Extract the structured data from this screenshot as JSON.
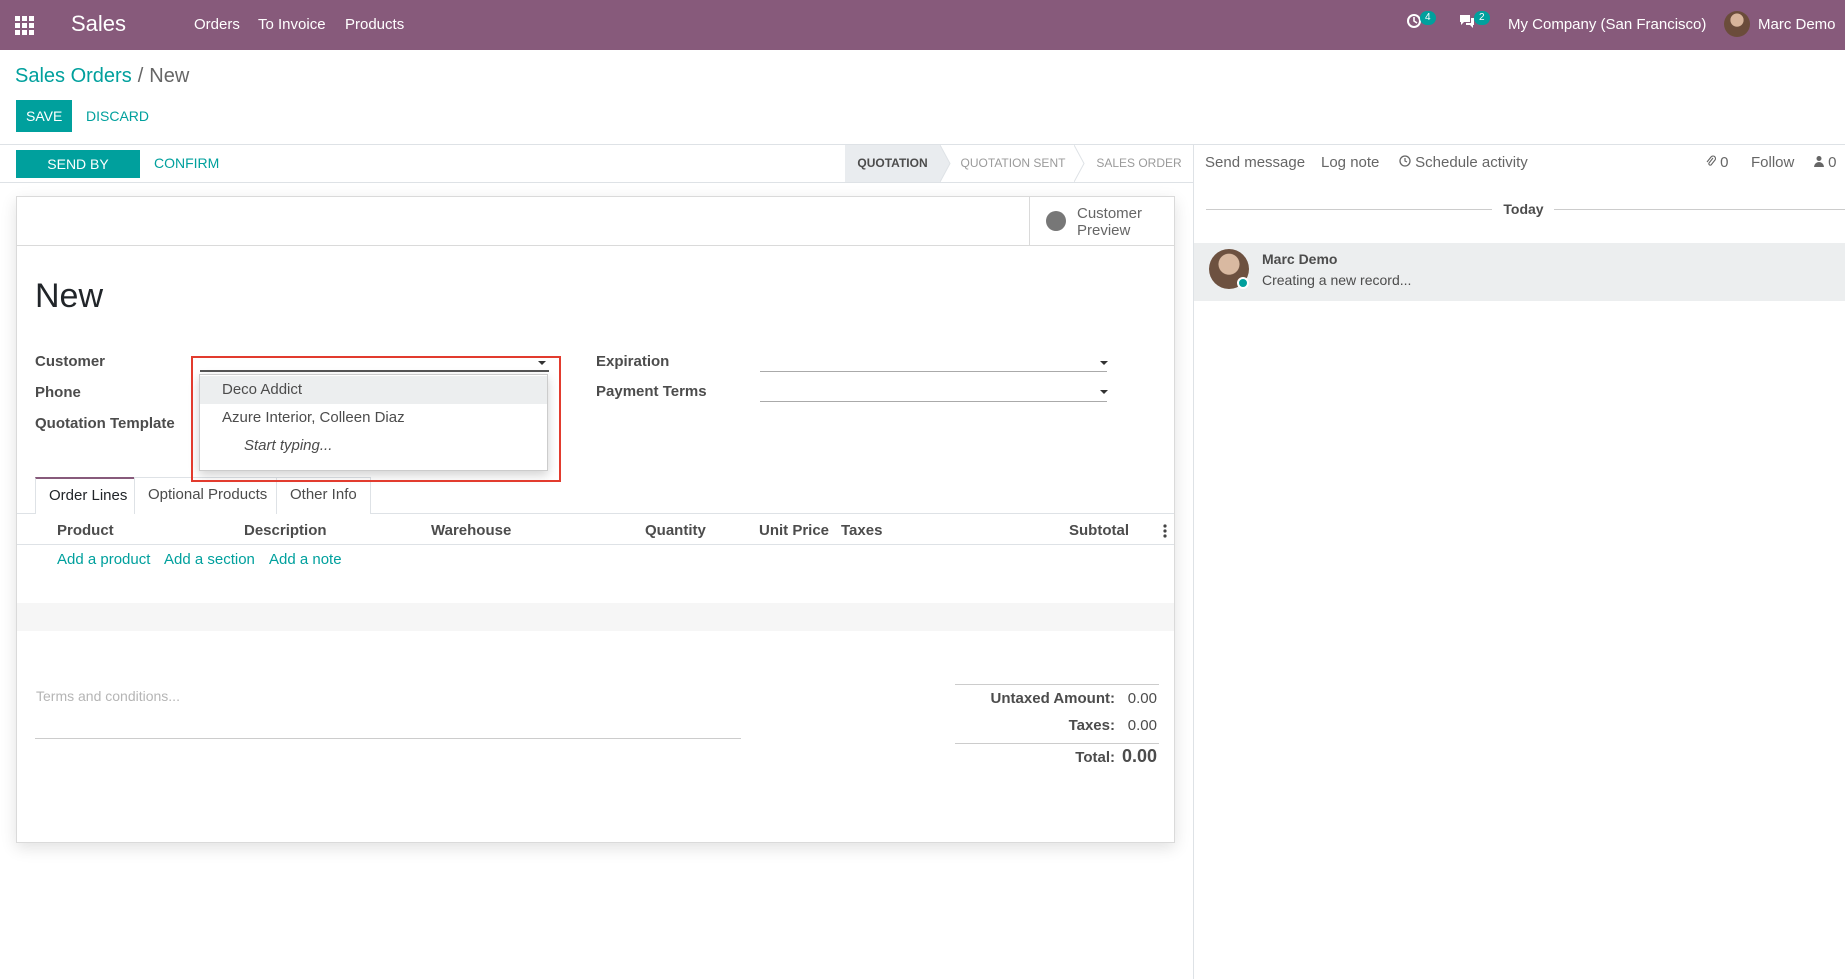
{
  "navbar": {
    "app_name": "Sales",
    "menu": [
      "Orders",
      "To Invoice",
      "Products"
    ],
    "activity_count": "4",
    "message_count": "2",
    "company": "My Company (San Francisco)",
    "user": "Marc Demo"
  },
  "breadcrumb": {
    "parent": "Sales Orders",
    "separator": "/",
    "current": "New"
  },
  "actions": {
    "save": "SAVE",
    "discard": "DISCARD",
    "send_email": "SEND BY EMAIL",
    "confirm": "CONFIRM"
  },
  "stages": [
    "QUOTATION",
    "QUOTATION SENT",
    "SALES ORDER"
  ],
  "active_stage": "QUOTATION",
  "stat_button": {
    "line1": "Customer",
    "line2": "Preview"
  },
  "record": {
    "title": "New"
  },
  "fields": {
    "customer": "Customer",
    "phone": "Phone",
    "quotation_template": "Quotation Template",
    "expiration": "Expiration",
    "payment_terms": "Payment Terms"
  },
  "dropdown": {
    "items": [
      "Deco Addict",
      "Azure Interior, Colleen Diaz"
    ],
    "hint": "Start typing..."
  },
  "tabs": [
    "Order Lines",
    "Optional Products",
    "Other Info"
  ],
  "order_lines": {
    "columns": [
      "Product",
      "Description",
      "Warehouse",
      "Quantity",
      "Unit Price",
      "Taxes",
      "Subtotal"
    ],
    "add_links": [
      "Add a product",
      "Add a section",
      "Add a note"
    ]
  },
  "terms_placeholder": "Terms and conditions...",
  "totals": {
    "untaxed_label": "Untaxed Amount:",
    "untaxed": "0.00",
    "taxes_label": "Taxes:",
    "taxes": "0.00",
    "total_label": "Total:",
    "total": "0.00"
  },
  "chatter": {
    "send_message": "Send message",
    "log_note": "Log note",
    "schedule_activity": "Schedule activity",
    "attachments": "0",
    "follow": "Follow",
    "followers": "0",
    "date_separator": "Today",
    "message_author": "Marc Demo",
    "message_body": "Creating a new record..."
  },
  "colors": {
    "brand": "#875a7b",
    "accent": "#00a09d",
    "highlight": "#e23b2e"
  }
}
